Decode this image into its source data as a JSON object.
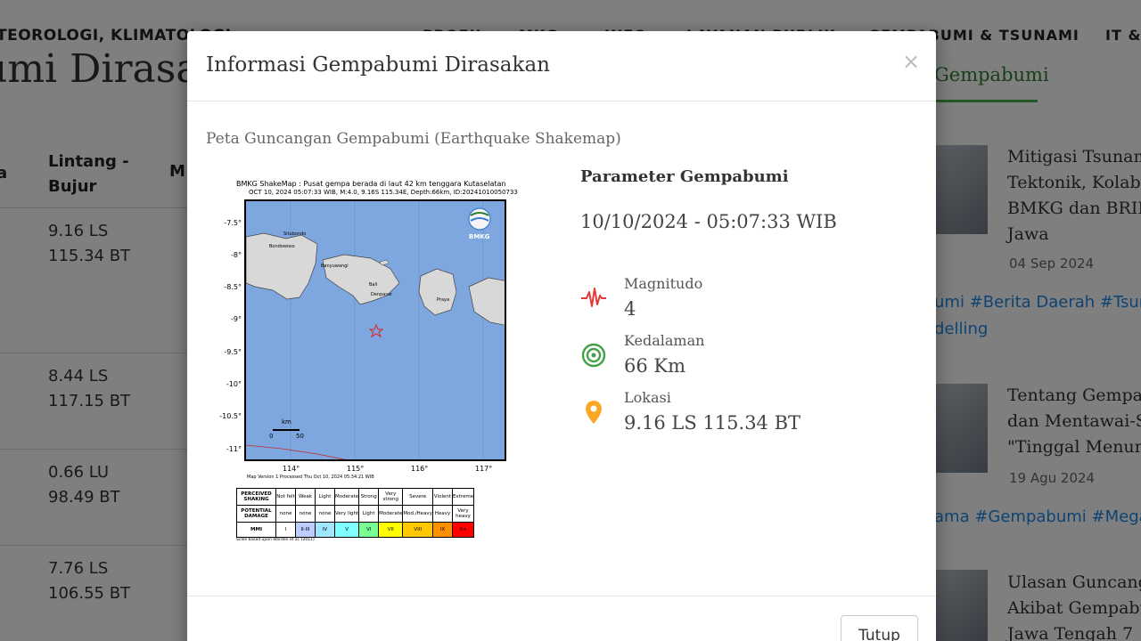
{
  "background": {
    "brand": "TEOROLOGI, KLIMATOLOGI",
    "nav": [
      "PROFIL",
      "MKG",
      "INFO",
      "LAYANAN PUBLIK",
      "GEMPABUMI & TSUNAMI",
      "IT &"
    ],
    "page_heading": "umi Dirasakan",
    "table": {
      "headers": {
        "a": "a",
        "latlon": "Lintang - Bujur",
        "m": "M"
      },
      "rows": [
        {
          "lat": "9.16 LS",
          "lon": "115.34 BT"
        },
        {
          "lat": "8.44 LS",
          "lon": "117.15 BT"
        },
        {
          "lat": "0.66 LU",
          "lon": "98.49 BT"
        },
        {
          "lat": "7.76 LS",
          "lon": "106.55 BT"
        }
      ]
    },
    "sidebar": {
      "tab": "Gempabumi",
      "news": [
        {
          "title": [
            "Mitigasi Tsunami",
            "Tektonik, Kolabo",
            "BMKG dan BRIN",
            "Jawa"
          ],
          "date": "04 Sep 2024",
          "tags": [
            "umi #Berita Daerah #Tsun",
            "delling"
          ]
        },
        {
          "title": [
            "Tentang Gempa",
            "dan Mentawai-S",
            "\"Tinggal Menun"
          ],
          "date": "19 Agu 2024",
          "tags": [
            "ama #Gempabumi #Mega"
          ]
        },
        {
          "title": [
            "Ulasan Guncang",
            "Akibat Gempabu",
            "Jawa Tengah 7"
          ],
          "date": "",
          "tags": []
        }
      ]
    }
  },
  "modal": {
    "title": "Informasi Gempabumi Dirasakan",
    "close_symbol": "×",
    "section_title": "Peta Guncangan Gempabumi (Earthquake Shakemap)",
    "shakemap": {
      "caption_line1": "BMKG ShakeMap : Pusat gempa berada di laut 42 km tenggara Kutaselatan",
      "caption_line2": "OCT 10, 2024 05:07:33 WIB, M:4.0, 9.16S 115.34E, Depth:66km, ID:20241010050733",
      "logo_text": "BMKG",
      "y_ticks": [
        "-7.5°",
        "-8°",
        "-8.5°",
        "-9°",
        "-9.5°",
        "-10°",
        "-10.5°",
        "-11°"
      ],
      "x_ticks": [
        "114°",
        "115°",
        "116°",
        "117°"
      ],
      "scale_unit": "km",
      "scale_labels": [
        "0",
        "50"
      ],
      "place_labels": [
        "Situbondo",
        "Bondowoso",
        "Banyuwangi",
        "Bali",
        "Denpasar",
        "Praya"
      ],
      "version_text": "Map Version 1 Processed Thu Oct 10, 2024 05:34:21 WIB",
      "intensity_table": {
        "row_labels": [
          "PERCEIVED SHAKING",
          "POTENTIAL DAMAGE",
          "MMI"
        ],
        "shaking": [
          "Not felt",
          "Weak",
          "Light",
          "Moderate",
          "Strong",
          "Very strong",
          "Severe",
          "Violent",
          "Extreme"
        ],
        "damage": [
          "none",
          "none",
          "none",
          "Very light",
          "Light",
          "Moderate",
          "Mod./Heavy",
          "Heavy",
          "Very heavy"
        ],
        "mmi": [
          "I",
          "II-III",
          "IV",
          "V",
          "VI",
          "VII",
          "VIII",
          "IX",
          "X+"
        ],
        "mmi_colors": [
          "#ffffff",
          "#bfccff",
          "#a0e6ff",
          "#80ffff",
          "#7aff93",
          "#ffff00",
          "#ffc800",
          "#ff9100",
          "#ff0000"
        ]
      },
      "scale_footnote": "Scale based upon Worden et al. (2011)"
    },
    "parameters": {
      "title": "Parameter Gempabumi",
      "datetime": "10/10/2024 - 05:07:33 WIB",
      "magnitude": {
        "label": "Magnitudo",
        "value": "4",
        "icon": "seismograph-icon",
        "color": "#e53935"
      },
      "depth": {
        "label": "Kedalaman",
        "value": "66 Km",
        "icon": "depth-rings-icon",
        "color": "#43a047"
      },
      "location": {
        "label": "Lokasi",
        "value": "9.16 LS 115.34 BT",
        "icon": "location-pin-icon",
        "color": "#f9a825"
      }
    },
    "footer": {
      "close_label": "Tutup"
    }
  }
}
